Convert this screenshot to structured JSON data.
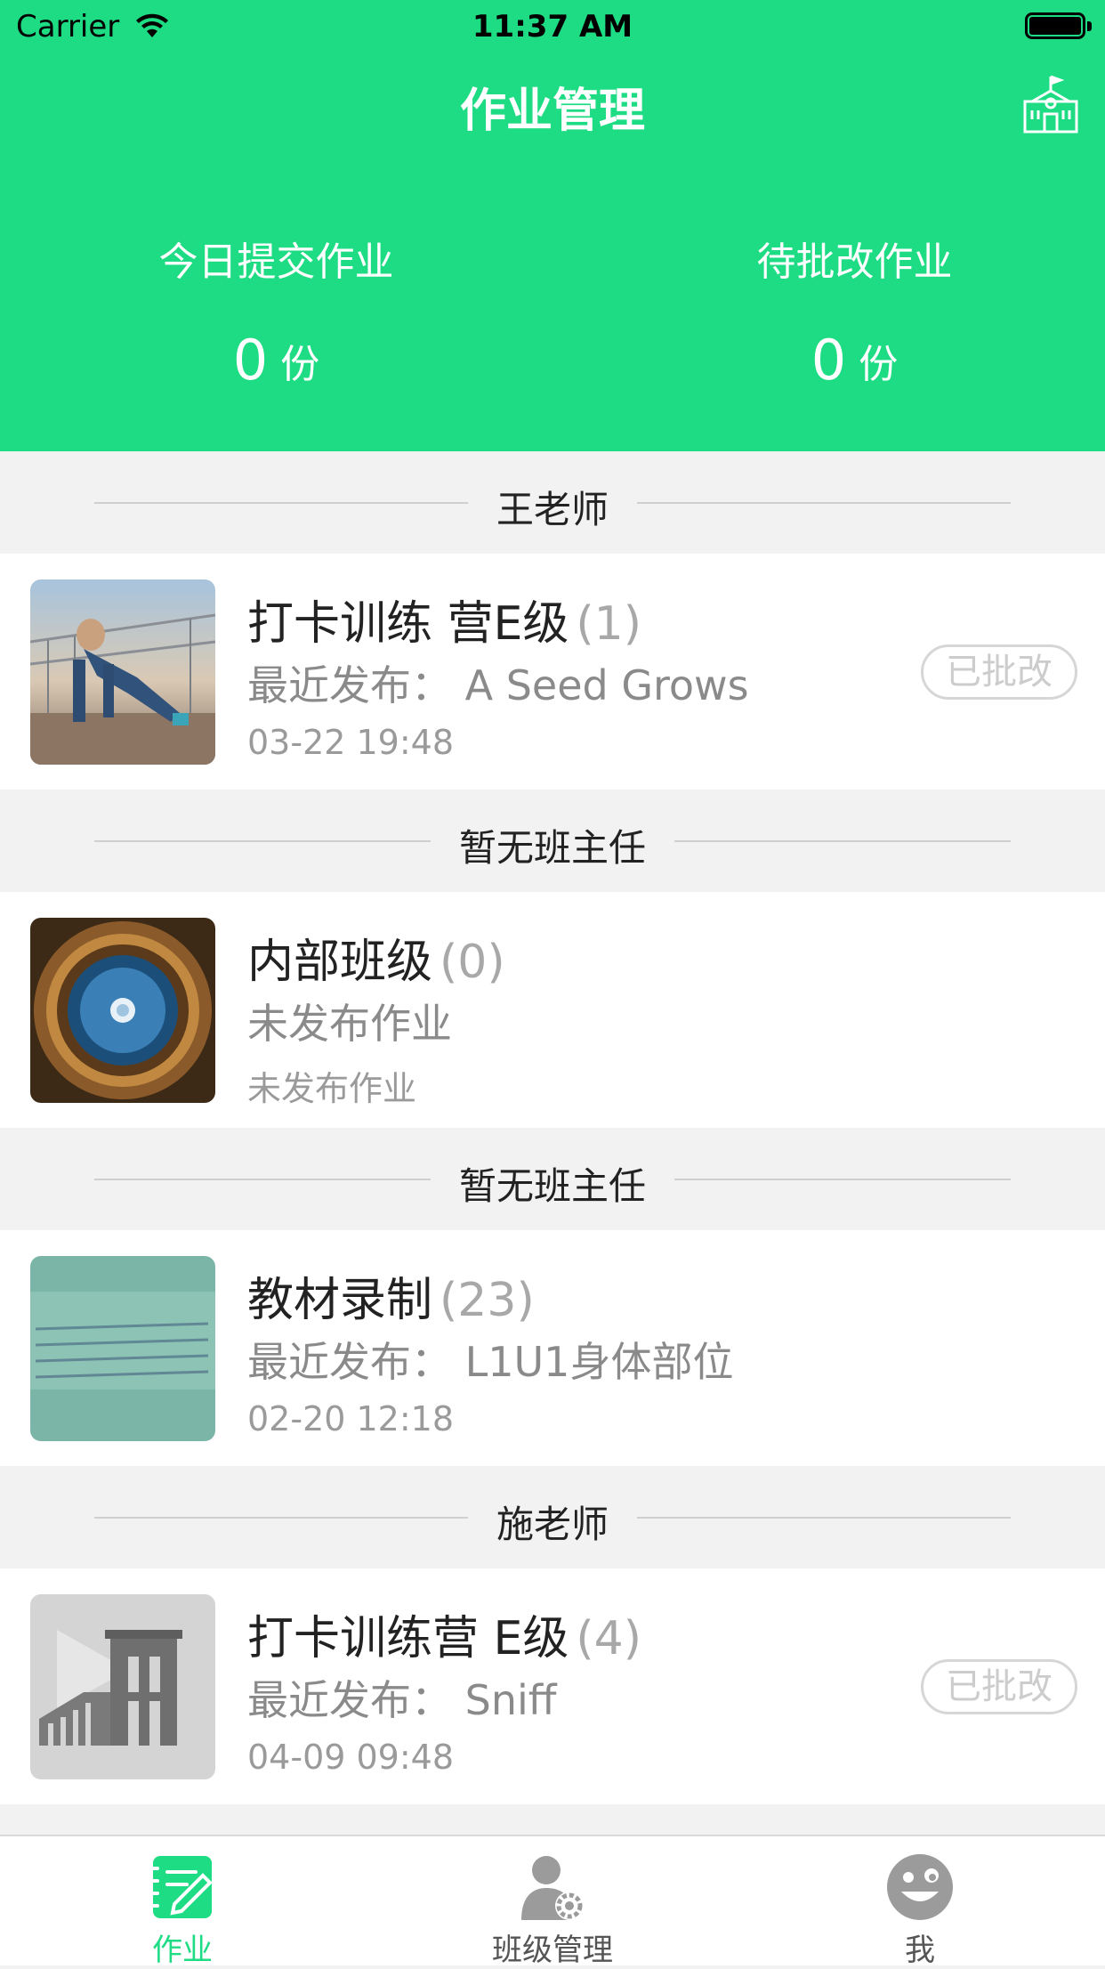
{
  "status_bar": {
    "carrier": "Carrier",
    "time": "11:37 AM"
  },
  "header": {
    "title": "作业管理",
    "stats": [
      {
        "label": "今日提交作业",
        "value": "0",
        "unit": "份"
      },
      {
        "label": "待批改作业",
        "value": "0",
        "unit": "份"
      }
    ]
  },
  "sections": [
    {
      "teacher": "王老师",
      "class_name": "打卡训练 营E级",
      "count": "(1)",
      "subtitle": "最近发布：  A Seed Grows",
      "date": "03-22 19:48",
      "badge": "已批改"
    },
    {
      "teacher": "暂无班主任",
      "class_name": "内部班级",
      "count": "(0)",
      "subtitle": "未发布作业",
      "date": "未发布作业",
      "badge": ""
    },
    {
      "teacher": "暂无班主任",
      "class_name": "教材录制",
      "count": "(23)",
      "subtitle": "最近发布：  L1U1身体部位",
      "date": "02-20 12:18",
      "badge": ""
    },
    {
      "teacher": "施老师",
      "class_name": "打卡训练营 E级",
      "count": "(4)",
      "subtitle": "最近发布：  Sniff",
      "date": "04-09 09:48",
      "badge": "已批改"
    }
  ],
  "tabbar": {
    "items": [
      {
        "label": "作业",
        "icon": "homework-icon",
        "active": true
      },
      {
        "label": "班级管理",
        "icon": "class-manage-icon",
        "active": false
      },
      {
        "label": "我",
        "icon": "profile-icon",
        "active": false
      }
    ]
  },
  "colors": {
    "brand": "#1edc83",
    "inactive": "#9b9b9b",
    "text": "#222222"
  }
}
